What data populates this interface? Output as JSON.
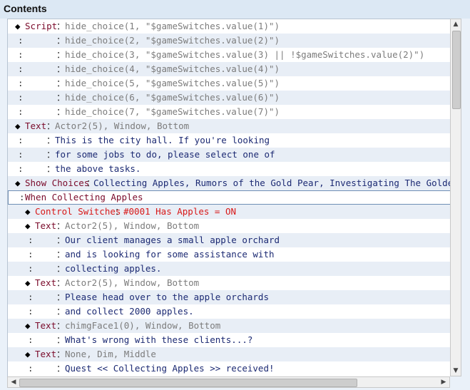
{
  "header": {
    "title": "Contents"
  },
  "rows": [
    {
      "prefix": "◆",
      "cmd": "Script",
      "sep": "：",
      "param": "hide_choice(1, \"$gameSwitches.value(1)\")"
    },
    {
      "prefix": ":",
      "cmd": "",
      "sep": "：",
      "param": "hide_choice(2, \"$gameSwitches.value(2)\")"
    },
    {
      "prefix": ":",
      "cmd": "",
      "sep": "：",
      "param": "hide_choice(3, \"$gameSwitches.value(3) || !$gameSwitches.value(2)\")"
    },
    {
      "prefix": ":",
      "cmd": "",
      "sep": "：",
      "param": "hide_choice(4, \"$gameSwitches.value(4)\")"
    },
    {
      "prefix": ":",
      "cmd": "",
      "sep": "：",
      "param": "hide_choice(5, \"$gameSwitches.value(5)\")"
    },
    {
      "prefix": ":",
      "cmd": "",
      "sep": "：",
      "param": "hide_choice(6, \"$gameSwitches.value(6)\")"
    },
    {
      "prefix": ":",
      "cmd": "",
      "sep": "：",
      "param": "hide_choice(7, \"$gameSwitches.value(7)\")"
    },
    {
      "prefix": "◆",
      "cmd": "Text",
      "sep": "：",
      "param": "Actor2(5), Window, Bottom"
    },
    {
      "prefix": ":",
      "cmd": "",
      "sep": "：",
      "param": "This is the city hall. If you're looking"
    },
    {
      "prefix": ":",
      "cmd": "",
      "sep": "：",
      "param": "for some jobs to do, please select one of"
    },
    {
      "prefix": ":",
      "cmd": "",
      "sep": "：",
      "param": "the above tasks."
    },
    {
      "prefix": "◆",
      "cmd": "Show Choices",
      "sep": "：",
      "param": "Collecting Apples, Rumors of the Gold Pear, Investigating The Golden Pear"
    },
    {
      "prefix": ":",
      "cmd": "When Collecting Apples",
      "sep": "",
      "param": ""
    },
    {
      "prefix": "◆",
      "cmd": "Control Switches",
      "sep": "：",
      "param": "#0001 Has Apples = ON"
    },
    {
      "prefix": "◆",
      "cmd": "Text",
      "sep": "：",
      "param": "Actor2(5), Window, Bottom"
    },
    {
      "prefix": ":",
      "cmd": "",
      "sep": "：",
      "param": "Our client manages a small apple orchard"
    },
    {
      "prefix": ":",
      "cmd": "",
      "sep": "：",
      "param": "and is looking for some assistance with"
    },
    {
      "prefix": ":",
      "cmd": "",
      "sep": "：",
      "param": "collecting apples."
    },
    {
      "prefix": "◆",
      "cmd": "Text",
      "sep": "：",
      "param": "Actor2(5), Window, Bottom"
    },
    {
      "prefix": ":",
      "cmd": "",
      "sep": "：",
      "param": "Please head over to the apple orchards"
    },
    {
      "prefix": ":",
      "cmd": "",
      "sep": "：",
      "param": "and collect 2000 apples."
    },
    {
      "prefix": "◆",
      "cmd": "Text",
      "sep": "：",
      "param": "chimgFace1(0), Window, Bottom"
    },
    {
      "prefix": ":",
      "cmd": "",
      "sep": "：",
      "param": "What's wrong with these clients...?"
    },
    {
      "prefix": "◆",
      "cmd": "Text",
      "sep": "：",
      "param": "None, Dim, Middle"
    },
    {
      "prefix": ":",
      "cmd": "",
      "sep": "：",
      "param": "Quest << Collecting Apples >> received!"
    }
  ],
  "colors": {
    "command": "#7a0a2a",
    "control_switches": "#d81818",
    "dialogue_text": "#1c2a73",
    "parameter": "#7c7c7c",
    "row_alt": "#e8eef6",
    "background": "#eaf1f9"
  }
}
